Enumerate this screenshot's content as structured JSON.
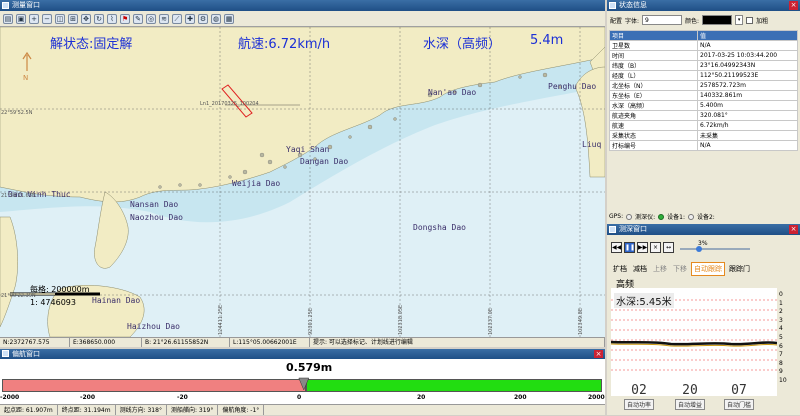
{
  "map_window": {
    "title": "测量窗口",
    "overlay": {
      "status": "解状态:固定解",
      "speed": "航速:6.72km/h",
      "depth_label": "水深（高频）",
      "depth_value": "5.4m"
    },
    "place_names": [
      "Dao Vinh Thuc",
      "Nansan Dao",
      "Naozhou Dao",
      "Hainan Dao",
      "Haizhou Dao",
      "Weijia Dao",
      "Yaqi Shan",
      "Dangan Dao",
      "Nan'ao Dao",
      "Penghu Dao",
      "Dongsha Dao",
      "Liuq"
    ],
    "track_label": "Ln1_20170325_100204",
    "lat_labels": [
      "22°59'52.5N",
      "21°59'21.63N",
      "21°00'22.39N"
    ],
    "lon_labels": [
      "124411.25E",
      "92301.25E",
      "102318.05E",
      "102337.0E",
      "102349.8E"
    ],
    "scale": {
      "text": "每格: 200000m",
      "ratio": "1: 4746093"
    },
    "north_label": "N"
  },
  "status_bar": {
    "n": "N:2372767.575",
    "e": "E:368650.000",
    "b": "B: 21°26.61155852N",
    "l": "L:115°05.00662001E",
    "hint": "提示: 可以选择标记、计划线进行编辑"
  },
  "deviation_window": {
    "title": "偏航窗口",
    "offset": "0.579m",
    "ticks": [
      "-2000",
      "-200",
      "-20",
      "0",
      "20",
      "200",
      "2000"
    ],
    "offset_fraction": 0.503,
    "stats": [
      "起点距: 61.907m",
      "终点距: 31.194m",
      "测线方向: 318°",
      "测船艏向: 319°",
      "偏航角度: -1°"
    ]
  },
  "status_panel": {
    "title": "状态信息",
    "config_label": "配置",
    "font_label": "字体:",
    "font_value": "9",
    "color_label": "颜色:",
    "bold_label": "加粗",
    "color_swatch": "#000000",
    "table_header": [
      "项目",
      "值"
    ],
    "rows": [
      [
        "卫星数",
        "N/A"
      ],
      [
        "时间",
        "2017-03-25 10:03:44.200"
      ],
      [
        "纬度（B）",
        "23°16.04992343N"
      ],
      [
        "经度（L）",
        "112°50.21199523E"
      ],
      [
        "北坐标（N）",
        "2578572.723m"
      ],
      [
        "东坐标（E）",
        "140332.861m"
      ],
      [
        "水深（高频）",
        "5.400m"
      ],
      [
        "航迹夹角",
        "320.081°"
      ],
      [
        "航速",
        "6.72km/h"
      ],
      [
        "采集状态",
        "未采集"
      ],
      [
        "打标编号",
        "N/A"
      ]
    ],
    "gps": {
      "label": "GPS:",
      "items": [
        "测深仪:",
        "设备1:",
        "设备2:"
      ]
    }
  },
  "sounder_window": {
    "title": "测深窗口",
    "progress": "3%",
    "progress_fraction": 0.03,
    "tabs": [
      "扩档",
      "减档",
      "上移",
      "下移",
      "自动跟踪",
      "跟踪门"
    ],
    "channel": "高频",
    "depth": "水深:5.45米",
    "axis": [
      "0",
      "1",
      "2",
      "3",
      "4",
      "5",
      "6",
      "7",
      "8",
      "9",
      "10"
    ],
    "counters": [
      {
        "value": "02",
        "label": "自动功率"
      },
      {
        "value": "20",
        "label": "自动增益"
      },
      {
        "value": "07",
        "label": "自动门槛"
      }
    ]
  },
  "colors": {
    "accent": "#1b2fd6",
    "land": "#f2ecc4",
    "sea": "#dff0f6",
    "left_bar": "#f08080",
    "right_bar": "#22dd11",
    "title_bar": "#2c5f98"
  }
}
